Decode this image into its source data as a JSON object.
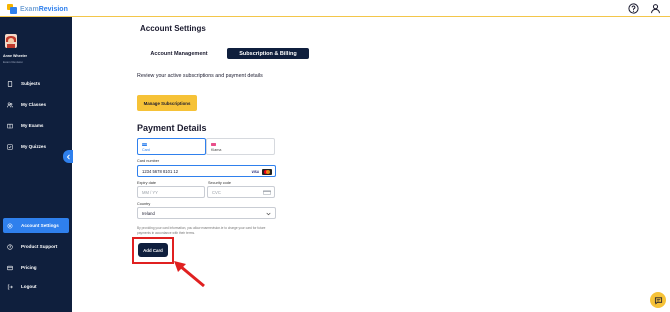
{
  "app": {
    "logo_prefix": "Exam",
    "logo_suffix": "Revision"
  },
  "user": {
    "name": "Anne Wheeler",
    "subtitle": "Exam Revision"
  },
  "sidebar": {
    "items": [
      {
        "label": "Subjects",
        "icon": "phone-icon"
      },
      {
        "label": "My Classes",
        "icon": "users-icon"
      },
      {
        "label": "My Exams",
        "icon": "book-icon"
      },
      {
        "label": "My Quizzes",
        "icon": "checkbox-icon"
      },
      {
        "label": "Account Settings",
        "icon": "gear-icon",
        "active": true
      },
      {
        "label": "Product Support",
        "icon": "help-icon"
      },
      {
        "label": "Pricing",
        "icon": "card-icon"
      },
      {
        "label": "Logout",
        "icon": "logout-icon"
      }
    ]
  },
  "main": {
    "title": "Account Settings",
    "tabs": [
      {
        "label": "Account Management",
        "active": false
      },
      {
        "label": "Subscription & Billing",
        "active": true
      }
    ],
    "review_text": "Review your active subscriptions and payment details",
    "manage_button": "Manage Subscriptions",
    "payment_title": "Payment Details",
    "methods": [
      {
        "label": "Card",
        "selected": true
      },
      {
        "label": "Klarna",
        "selected": false
      }
    ],
    "card_number": {
      "label": "Card number",
      "value": "1234 5678 8101 12"
    },
    "card_brand": "VISA",
    "expiry": {
      "label": "Expiry date",
      "placeholder": "MM / YY"
    },
    "security": {
      "label": "Security code",
      "placeholder": "CVC"
    },
    "country": {
      "label": "Country",
      "value": "Ireland"
    },
    "disclaimer": "By providing your card information, you allow examrevision.ie to charge your card for future payments in accordance with their terms.",
    "add_card_button": "Add Card"
  },
  "colors": {
    "accent": "#2f80ed",
    "sidebar": "#0f1f3d",
    "yellow": "#f6c237",
    "highlight": "#e02020"
  }
}
